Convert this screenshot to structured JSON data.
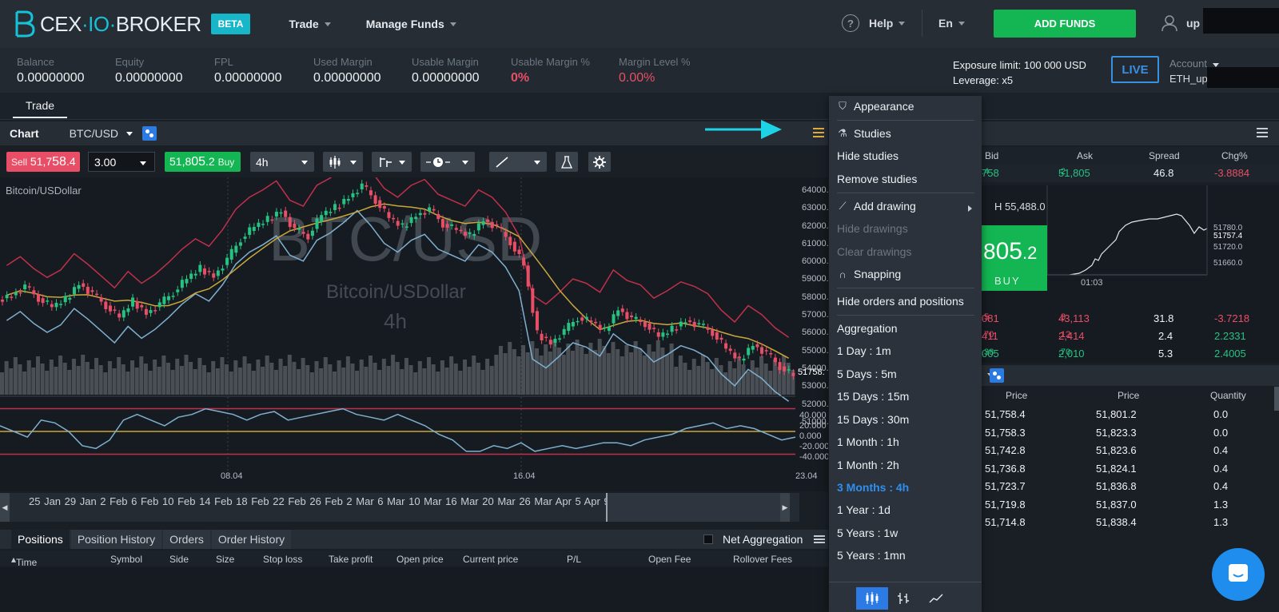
{
  "header": {
    "logo_text_a": "CEX",
    "logo_text_b": "IO",
    "logo_text_c": "BROKER",
    "beta": "BETA",
    "nav": [
      "Trade",
      "Manage Funds"
    ],
    "help": "Help",
    "language": "En",
    "add_funds": "ADD FUNDS",
    "user": "up"
  },
  "stats": {
    "items": [
      {
        "label": "Balance",
        "value": "0.00000000"
      },
      {
        "label": "Equity",
        "value": "0.00000000"
      },
      {
        "label": "FPL",
        "value": "0.00000000"
      },
      {
        "label": "Used Margin",
        "value": "0.00000000"
      },
      {
        "label": "Usable Margin",
        "value": "0.00000000"
      },
      {
        "label": "Usable Margin %",
        "value": "0%"
      },
      {
        "label": "Margin Level %",
        "value": "0.00%"
      }
    ],
    "exposure_limit": "Exposure limit: 100 000 USD",
    "leverage": "Leverage: x5",
    "live": "LIVE",
    "account_label": "Account",
    "account_value": "ETH_up"
  },
  "tabs": {
    "trade": "Trade"
  },
  "chart": {
    "title": "Chart",
    "symbol": "BTC/USD",
    "sell_label": "Sell",
    "sell_price_a": "51,7",
    "sell_price_b": "58",
    "sell_price_c": ".4",
    "quantity": "3.00",
    "buy_price_a": "51,8",
    "buy_price_b": "05",
    "buy_price_c": ".2",
    "buy_label": "Buy",
    "interval": "4h",
    "subtitle": "Bitcoin/USDollar",
    "watermark_symbol": "BTC/USD",
    "watermark_name": "Bitcoin/USDollar",
    "watermark_interval": "4h",
    "price_tag": "51758.",
    "osc_axis": [
      "40.000",
      "20.000",
      "0.000",
      "-20.000",
      "-40.000"
    ],
    "x_dates": [
      "08.04",
      "16.04",
      "23.04"
    ],
    "navigator_dates": "25 Jan 29 Jan 2 Feb  6 Feb  10 Feb 14 Feb 18 Feb 22 Feb 26 Feb 2 Mar  6 Mar  10 Mar    16 Mar 20 Mar    26 Mar       Apr   5 Apr   9 Apr   13 Apr 17 Apr 21"
  },
  "chart_data": {
    "type": "candlestick",
    "title": "BTC/USD",
    "subtitle": "Bitcoin/USDollar",
    "interval": "4h",
    "y_ticks": [
      64000,
      63000,
      62000,
      61000,
      60000,
      59000,
      58000,
      57000,
      56000,
      55000,
      54000,
      53000,
      52000,
      51000
    ],
    "ylim": [
      50500,
      64600
    ],
    "last_price": 51758.4,
    "close": [
      57200,
      57800,
      57000,
      56400,
      56900,
      58000,
      57300,
      56500,
      55700,
      56800,
      56000,
      56600,
      57400,
      58300,
      59000,
      58500,
      59600,
      61000,
      61800,
      62300,
      62900,
      61600,
      61200,
      62600,
      63100,
      63800,
      64600,
      63600,
      62400,
      61800,
      62600,
      63000,
      62000,
      61600,
      61200,
      62300,
      61800,
      60800,
      59200,
      54600,
      54000,
      54800,
      55700,
      55400,
      54800,
      56300,
      55600,
      55300,
      54400,
      54900,
      55500,
      55200,
      54700,
      53600,
      52800,
      53900,
      53300,
      52400,
      51758
    ],
    "oscillator": [
      10,
      0,
      -10,
      20,
      15,
      0,
      -25,
      -30,
      -15,
      20,
      30,
      20,
      10,
      25,
      30,
      40,
      35,
      30,
      20,
      30,
      35,
      20,
      25,
      30,
      35,
      40,
      30,
      25,
      20,
      30,
      20,
      10,
      -5,
      -15,
      -35,
      -35,
      -25,
      -30,
      -20,
      -35,
      -30,
      -25,
      -30,
      -25,
      -20,
      -20,
      -25,
      -15,
      -10,
      -5,
      5,
      10,
      15,
      5,
      10,
      5,
      -5,
      -15,
      -10
    ],
    "osc_ticks": [
      40,
      20,
      0,
      -20,
      -40
    ],
    "x_dates": [
      "08.04",
      "16.04",
      "23.04"
    ]
  },
  "bottom": {
    "tabs": [
      "Positions",
      "Position History",
      "Orders",
      "Order History"
    ],
    "net_aggregation": "Net Aggregation",
    "columns": [
      "Time and date",
      "Symbol",
      "Side",
      "Size",
      "Stop loss",
      "Take profit",
      "Open price",
      "Current price",
      "P/L",
      "Open Fee",
      "Rollover Fees"
    ]
  },
  "quotes": {
    "columns": [
      "Bid",
      "Ask",
      "Spread",
      "Chg%"
    ],
    "rows": [
      {
        "bid_a": "758",
        "bid_b": ".4",
        "ask_a": "51,805",
        "ask_b": ".2",
        "spread": "46.8",
        "chg": "-3.8884"
      },
      {
        "bid_a": "081",
        "bid_b": ".5",
        "ask_a": "43,113",
        "ask_b": ".3",
        "spread": "31.8",
        "chg": "-3.7218"
      },
      {
        "bid_a": "411",
        "bid_b": ".70",
        "ask_a": "2,414",
        "ask_b": ".12",
        "spread": "2.4",
        "chg": "2.2331"
      },
      {
        "bid_a": "005",
        "bid_b": ".38",
        "ask_a": "2,010",
        "ask_b": ".70",
        "spread": "5.3",
        "chg": "2.4005"
      }
    ],
    "high": "H 55,488.0",
    "buy_big_a": "8",
    "buy_big_b": "05",
    "buy_big_c": ".2",
    "buy_word": "BUY",
    "mini_ticks": [
      "51780.0",
      "51757.4",
      "51720.0",
      "51660.0"
    ],
    "mini_time": "01:03"
  },
  "orderbook": {
    "columns": [
      "Price",
      "Price",
      "Quantity"
    ],
    "rows": [
      {
        "bid": "51,758.4",
        "ask": "51,801.2",
        "qty": "0.0"
      },
      {
        "bid": "51,758.3",
        "ask": "51,823.3",
        "qty": "0.0"
      },
      {
        "bid": "51,742.8",
        "ask": "51,823.6",
        "qty": "0.4"
      },
      {
        "bid": "51,736.8",
        "ask": "51,824.1",
        "qty": "0.4"
      },
      {
        "bid": "51,723.7",
        "ask": "51,836.8",
        "qty": "0.4"
      },
      {
        "bid": "51,719.8",
        "ask": "51,837.0",
        "qty": "1.3"
      },
      {
        "bid": "51,714.8",
        "ask": "51,838.4",
        "qty": "1.3"
      }
    ]
  },
  "menu": {
    "appearance": "Appearance",
    "studies": "Studies",
    "hide_studies": "Hide studies",
    "remove_studies": "Remove studies",
    "add_drawing": "Add drawing",
    "hide_drawings": "Hide drawings",
    "clear_drawings": "Clear drawings",
    "snapping": "Snapping",
    "hide_orders": "Hide orders and positions",
    "aggregation": "Aggregation",
    "agg_items": [
      "1 Day : 1m",
      "5 Days : 5m",
      "15 Days : 15m",
      "15 Days : 30m",
      "1 Month : 1h",
      "1 Month : 2h",
      "3 Months : 4h",
      "1 Year : 1d",
      "5 Years : 1w",
      "5 Years : 1mn"
    ],
    "active_index": 6
  },
  "colors": {
    "accent": "#17b6c9",
    "buy": "#13b653",
    "sell": "#e94e67",
    "menu_active": "#2e8ff0",
    "annotation_arrow": "#1fd3e6"
  }
}
